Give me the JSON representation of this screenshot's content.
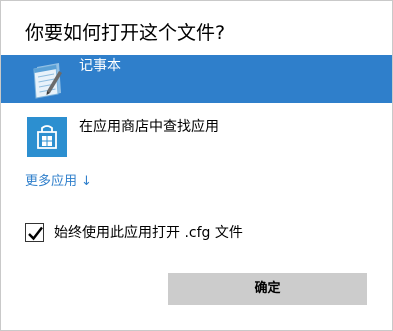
{
  "dialog": {
    "title": "你要如何打开这个文件?"
  },
  "apps": [
    {
      "label": "记事本",
      "icon": "notepad-icon",
      "selected": true
    },
    {
      "label": "在应用商店中查找应用",
      "icon": "store-icon",
      "selected": false
    }
  ],
  "more_apps": {
    "label": "更多应用",
    "arrow": "↓"
  },
  "always_use": {
    "label": "始终使用此应用打开 .cfg 文件",
    "checked": true
  },
  "ok_button": {
    "label": "确定"
  },
  "colors": {
    "accent": "#2f7fcb",
    "button_bg": "#cccccc",
    "store_tile": "#2c8fd0"
  }
}
